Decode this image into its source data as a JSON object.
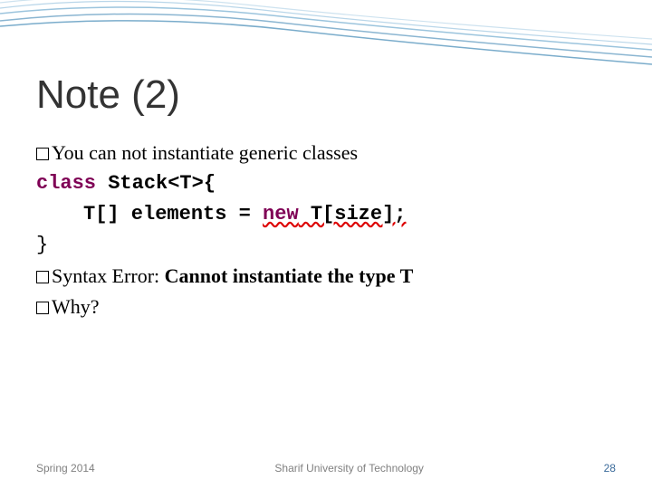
{
  "title": "Note (2)",
  "bullets": {
    "b1": "You can not  instantiate generic classes",
    "b2_prefix": "Syntax Error: ",
    "b2_bold": "Cannot instantiate the type T",
    "b3": "Why?"
  },
  "code": {
    "l1_kw": "class",
    "l1_rest": " Stack<T>{",
    "l2_a": "T[] elements = ",
    "l2_kw": "new",
    "l2_err": " T[size];",
    "l3": "}"
  },
  "footer": {
    "left": "Spring 2014",
    "center": "Sharif University of Technology",
    "right": "28"
  }
}
